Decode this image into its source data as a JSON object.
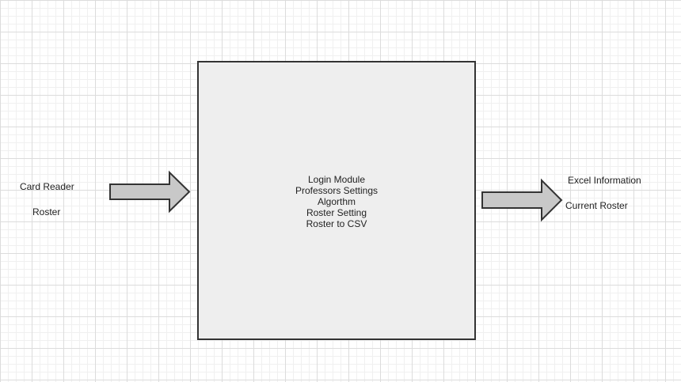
{
  "inputs": {
    "items": [
      "Card Reader",
      "Roster"
    ]
  },
  "process": {
    "lines": [
      "Login Module",
      "Professors Settings",
      "Algorthm",
      "Roster Setting",
      "Roster to CSV"
    ]
  },
  "outputs": {
    "items": [
      "Excel Information",
      "Current Roster"
    ]
  },
  "colors": {
    "box_fill": "#eeeeee",
    "arrow_fill": "#c8c8c8",
    "stroke": "#333333"
  }
}
